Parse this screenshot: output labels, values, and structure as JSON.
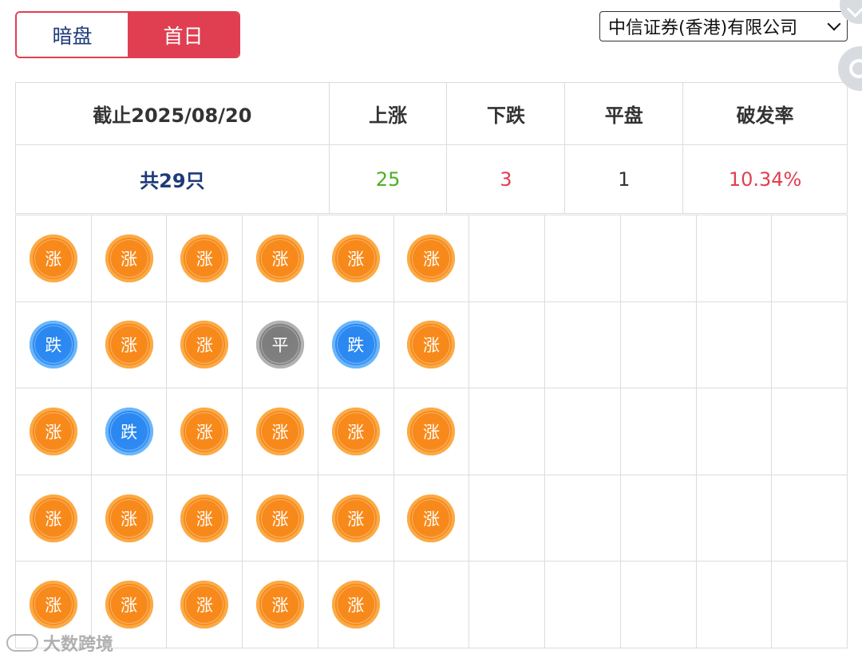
{
  "toggle": {
    "dark_label": "暗盘",
    "first_day_label": "首日",
    "active": "first_day"
  },
  "broker": {
    "selected": "中信证券(香港)有限公司"
  },
  "summary": {
    "headers": [
      "截止2025/08/20",
      "上涨",
      "下跌",
      "平盘",
      "破发率"
    ],
    "total": "共29只",
    "up": "25",
    "down": "3",
    "flat": "1",
    "break_rate": "10.34%"
  },
  "grid": {
    "columns": 11,
    "rows": 5,
    "status_labels": {
      "up": "涨",
      "down": "跌",
      "flat": "平"
    },
    "cells": [
      [
        "up",
        "up",
        "up",
        "up",
        "up",
        "up"
      ],
      [
        "down",
        "up",
        "up",
        "flat",
        "down",
        "up"
      ],
      [
        "up",
        "down",
        "up",
        "up",
        "up",
        "up"
      ],
      [
        "up",
        "up",
        "up",
        "up",
        "up",
        "up"
      ],
      [
        "up",
        "up",
        "up",
        "up",
        "up"
      ]
    ]
  },
  "colors": {
    "accent": "#e03f52",
    "navy": "#1f3a7a",
    "up_green": "#4caf24",
    "coin_orange": "#f7891a",
    "coin_blue": "#2c8af2",
    "coin_gray": "#808080"
  },
  "watermark": {
    "text": "大数跨境"
  }
}
